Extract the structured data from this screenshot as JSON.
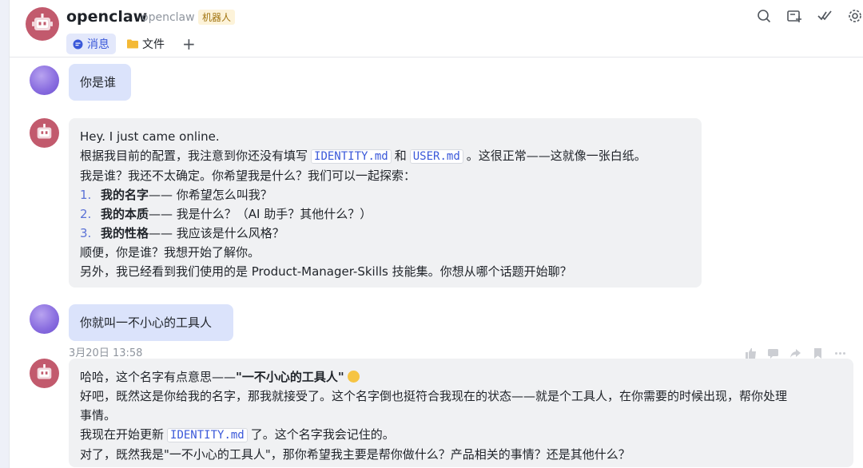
{
  "header": {
    "title": "openclaw",
    "subtitle": "openclaw",
    "badge": "机器人",
    "tabs": [
      {
        "label": "消息",
        "icon": "chat-bubble-icon",
        "active": true
      },
      {
        "label": "文件",
        "icon": "folder-icon",
        "active": false
      }
    ],
    "add_tab": "+",
    "icons": [
      "search-icon",
      "add-chat-icon",
      "check-icon",
      "settings-icon"
    ]
  },
  "messages": [
    {
      "sender": "user",
      "text": "你是谁"
    },
    {
      "sender": "bot",
      "line1": "Hey. I just came online.",
      "line2_pre": "根据我目前的配置，我注意到你还没有填写",
      "code1": "IDENTITY.md",
      "line2_mid": "和",
      "code2": "USER.md",
      "line2_post": "。这很正常——这就像一张白纸。",
      "line3": "我是谁？我还不太确定。你希望我是什么？我们可以一起探索：",
      "list": [
        {
          "num": "1.",
          "bold": "我的名字",
          "rest": " —— 你希望怎么叫我？"
        },
        {
          "num": "2.",
          "bold": "我的本质",
          "rest": " —— 我是什么？（AI 助手？其他什么？）"
        },
        {
          "num": "3.",
          "bold": "我的性格",
          "rest": " —— 我应该是什么风格？"
        }
      ],
      "line4": "顺便，你是谁？我想开始了解你。",
      "line5": "另外，我已经看到我们使用的是 Product-Manager-Skills 技能集。你想从哪个话题开始聊？"
    },
    {
      "sender": "user",
      "text": "你就叫一不小心的工具人"
    },
    {
      "sender": "bot",
      "timestamp": "3月20日 13:58",
      "line1_pre": "哈哈，这个名字有点意思——",
      "line1_bold": "\"一不小心的工具人\"",
      "line2": "好吧，既然这是你给我的名字，那我就接受了。这个名字倒也挺符合我现在的状态——就是个工具人，在你需要的时候出现，帮你处理",
      "line3": "事情。",
      "line4_pre": "我现在开始更新",
      "code": "IDENTITY.md",
      "line4_post": "了。这个名字我会记住的。",
      "line5": "对了，既然我是\"一不小心的工具人\"，那你希望我主要是帮你做什么？产品相关的事情？还是其他什么？"
    }
  ],
  "colors": {
    "accent": "#3a58d9",
    "user_bubble": "#dbe3fb",
    "bot_bubble": "#f0f1f3",
    "bot_avatar": "#c25a6d"
  }
}
